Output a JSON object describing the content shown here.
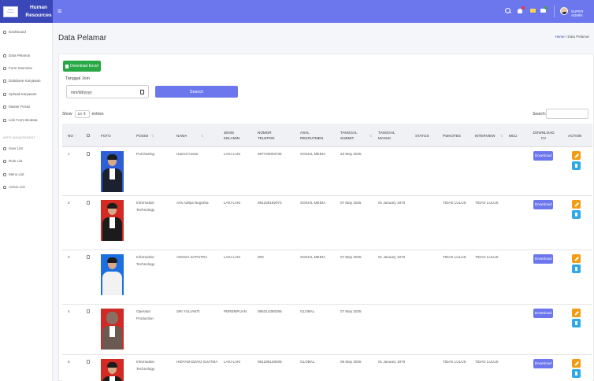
{
  "brand": {
    "name_line1": "Human",
    "name_line2": "Resources",
    "logo_line1": "Human",
    "logo_line2": "Resources"
  },
  "topbar": {
    "user": "SUPER ADMIN",
    "badge_colors": [
      "#e53935",
      "#43a047"
    ]
  },
  "sidebar": {
    "items": [
      {
        "label": "Dashboard",
        "icon": "dashboard-icon"
      },
      {
        "label": "Data Pelamar",
        "icon": "users-icon"
      },
      {
        "label": "Form Interview",
        "icon": "form-icon"
      },
      {
        "label": "Database Karyawan",
        "icon": "database-icon"
      },
      {
        "label": "Upload Karyawan",
        "icon": "upload-icon"
      },
      {
        "label": "Master Posisi",
        "icon": "check-icon"
      },
      {
        "label": "Link Form Biodata",
        "icon": "file-icon"
      }
    ],
    "section_heading": "APPS MANAGEMENT",
    "management_items": [
      {
        "label": "User List",
        "icon": "user-icon"
      },
      {
        "label": "Role List",
        "icon": "role-icon"
      },
      {
        "label": "Menu List",
        "icon": "menu-icon"
      },
      {
        "label": "Action List",
        "icon": "link-icon"
      }
    ]
  },
  "page": {
    "title": "Data Pelamar",
    "breadcrumb_home": "Home",
    "breadcrumb_sep": "/",
    "breadcrumb_current": "Data Pelamar"
  },
  "filters": {
    "download_excel": "Download Excel",
    "date_label": "Tanggal Join",
    "date_placeholder": "mm/dd/yyyy",
    "search_button": "Search"
  },
  "table_controls": {
    "show_label": "Show",
    "entries_value": "10",
    "entries_label": "entries",
    "search_label": "Search:"
  },
  "table": {
    "headers": [
      "NO",
      "",
      "FOTO",
      "POSISI",
      "NAMA",
      "JENIS KELAMIN",
      "NOMOR TELEPON",
      "ASAL REKRUTMEN",
      "TANGGAL SUBMIT",
      "TANGGAL MASUK",
      "STATUS",
      "PSIKOTES",
      "INTERVIEW",
      "MCU",
      "DOWNLOAD CV",
      "ACTION"
    ],
    "download_label": "Download",
    "rows": [
      {
        "no": "1",
        "posisi": "Purchasing",
        "nama": "Haerul Anwar",
        "jk": "LAKI-LAKI",
        "telp": "087720003735",
        "asal": "SOSIAL MEDIA",
        "submit": "23 May 2025",
        "masuk": "",
        "psikotes": "",
        "interview": "",
        "photo_bg": "#2f5fd6",
        "suit": "#1c2130"
      },
      {
        "no": "2",
        "posisi": "Information Technology",
        "nama": "Aris Aditya Nugraha",
        "jk": "LAKI-LAKI",
        "telp": "081239182074",
        "asal": "SOSIAL MEDIA",
        "submit": "07 May 2025",
        "masuk": "01 January 1970",
        "psikotes": "TIDAK LULUS",
        "interview": "TIDAK LULUS",
        "photo_bg": "#d42a24",
        "suit": "#1b1b1b"
      },
      {
        "no": "3",
        "posisi": "Information Technology",
        "nama": "ANGGA SAPUTRA",
        "jk": "LAKI-LAKI",
        "telp": "000",
        "asal": "SOSIAL MEDIA",
        "submit": "07 May 2025",
        "masuk": "01 January 1970",
        "psikotes": "TIDAK LULUS",
        "interview": "TIDAK LULUS",
        "photo_bg": "#1b6fe0",
        "suit": "#f2f2f2"
      },
      {
        "no": "4",
        "posisi": "Operator Production",
        "nama": "SRI YULIANTI",
        "jk": "PEREMPUAN",
        "telp": "085314390266",
        "asal": "GLOBAL",
        "submit": "07 May 2025",
        "masuk": "",
        "psikotes": "",
        "interview": "",
        "photo_bg": "#cf2a25",
        "suit": "#6b5a52"
      },
      {
        "no": "5",
        "posisi": "Information Technology",
        "nama": "HIDYAM DZAKI SUATMA",
        "jk": "LAKI-LAKI",
        "telp": "081288128405",
        "asal": "GLOBAL",
        "submit": "06 May 2025",
        "masuk": "01 January 1970",
        "psikotes": "TIDAK LULUS",
        "interview": "TIDAK LULUS",
        "photo_bg": "#d42a24",
        "suit": "#1b1b1b"
      }
    ]
  }
}
